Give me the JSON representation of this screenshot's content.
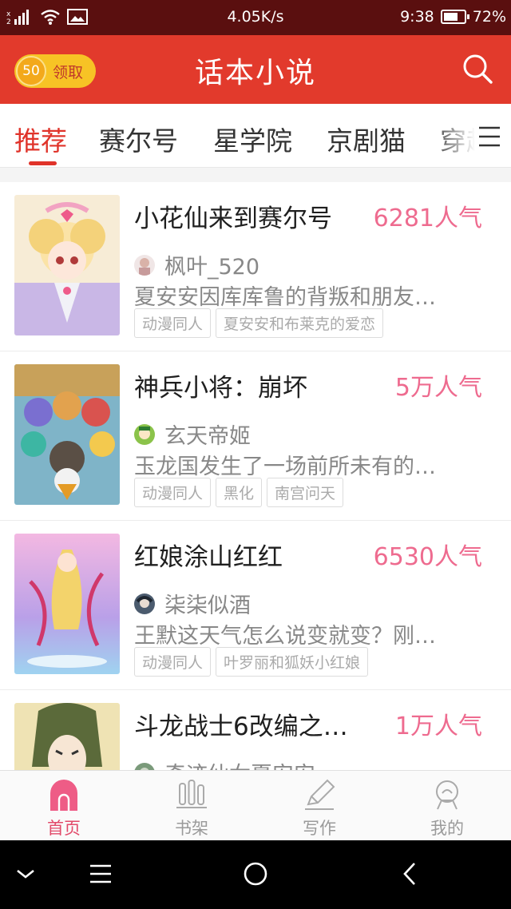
{
  "status_bar": {
    "network_speed": "4.05K/s",
    "time": "9:38",
    "battery_percent": "72%",
    "battery_level": 0.72
  },
  "header": {
    "coins": "50",
    "claim_label": "领取",
    "title": "话本小说",
    "search_icon": "search-icon"
  },
  "tabs": [
    {
      "label": "推荐",
      "active": true
    },
    {
      "label": "赛尔号"
    },
    {
      "label": "星学院"
    },
    {
      "label": "京剧猫"
    },
    {
      "label": "穿越"
    }
  ],
  "stories": [
    {
      "title": "小花仙来到赛尔号",
      "popularity": "6281人气",
      "author": "枫叶_520",
      "summary": "夏安安因库库鲁的背叛和朋友…",
      "tags": [
        "动漫同人",
        "夏安安和布莱克的爱恋"
      ]
    },
    {
      "title": "神兵小将：崩坏",
      "popularity": "5万人气",
      "author": "玄天帝姬",
      "summary": "玉龙国发生了一场前所未有的…",
      "tags": [
        "动漫同人",
        "黑化",
        "南宫问天"
      ]
    },
    {
      "title": "红娘涂山红红",
      "popularity": "6530人气",
      "author": "柒柒似酒",
      "summary": "王默这天气怎么说变就变？刚…",
      "tags": [
        "动漫同人",
        "叶罗丽和狐妖小红娘"
      ]
    },
    {
      "title": "斗龙战士6改编之…",
      "popularity": "1万人气",
      "author": "奇迹仙女夏安安",
      "summary": "",
      "tags": []
    }
  ],
  "bottom_nav": [
    {
      "label": "首页",
      "icon": "home-icon",
      "active": true
    },
    {
      "label": "书架",
      "icon": "bookshelf-icon"
    },
    {
      "label": "写作",
      "icon": "pen-icon"
    },
    {
      "label": "我的",
      "icon": "profile-icon"
    }
  ],
  "colors": {
    "header_red": "#e23a2c",
    "accent_red": "#e0332a",
    "popularity_pink": "#ee6b8f",
    "coin_gold": "#f7c325"
  }
}
